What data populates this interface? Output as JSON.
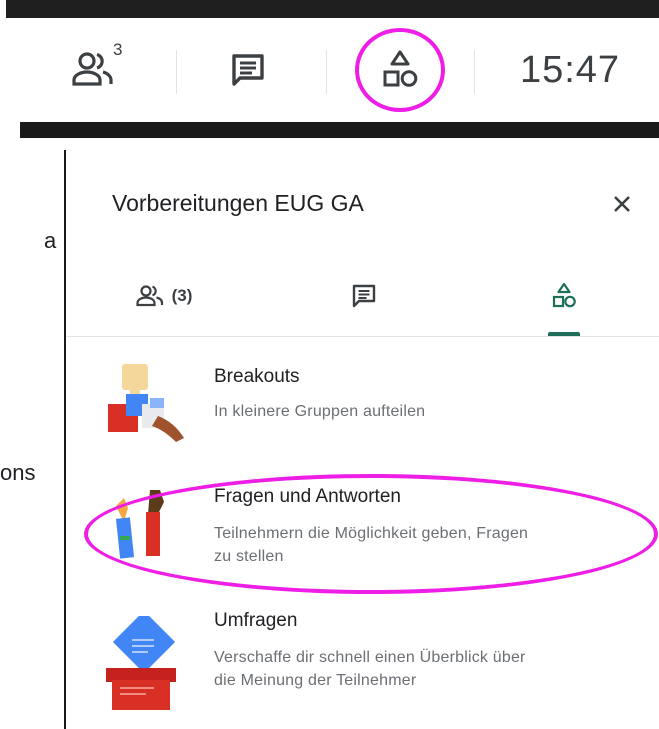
{
  "toolbar": {
    "people_badge": "3",
    "clock": "15:47",
    "icons": [
      "people-icon",
      "chat-icon",
      "activities-icon"
    ]
  },
  "left_fragments": {
    "a": "a",
    "ons": "ons"
  },
  "panel": {
    "title": "Vorbereitungen EUG GA",
    "tabs": [
      {
        "name": "people",
        "count": "(3)"
      },
      {
        "name": "chat"
      },
      {
        "name": "activities",
        "selected": true
      }
    ],
    "activities": [
      {
        "title": "Breakouts",
        "desc": "In kleinere Gruppen aufteilen"
      },
      {
        "title": "Fragen und Antworten",
        "desc_line1": "Teilnehmern die Möglichkeit geben, Fragen",
        "desc_line2": "zu stellen"
      },
      {
        "title": "Umfragen",
        "desc_line1": "Verschaffe dir schnell einen Überblick über",
        "desc_line2": "die Meinung der Teilnehmer"
      }
    ]
  },
  "colors": {
    "accent": "#1e6e59",
    "highlight": "#ee1ee6",
    "text_secondary": "#6b6f74"
  }
}
